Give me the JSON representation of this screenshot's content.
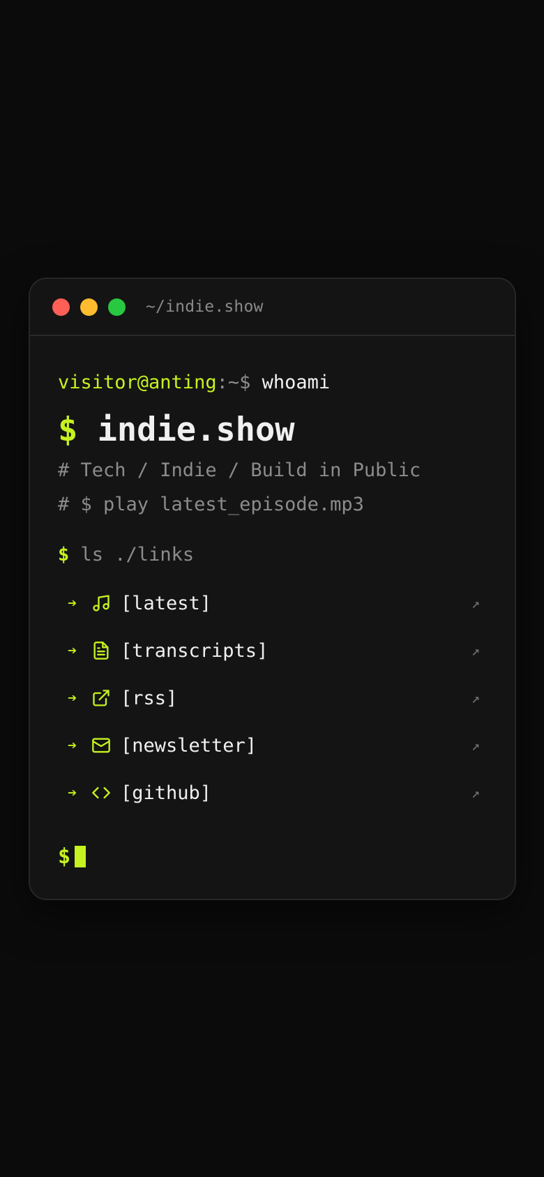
{
  "window": {
    "title": "~/indie.show",
    "dots": [
      "#fe5f57",
      "#febc2e",
      "#28c840"
    ]
  },
  "prompt": {
    "user": "visitor@anting",
    "path": ":~$",
    "command": "whoami"
  },
  "headline": {
    "dollar": "$",
    "name": "indie.show"
  },
  "comments": [
    "# Tech / Indie / Build in Public",
    "# $ play latest_episode.mp3"
  ],
  "ls": {
    "dollar": "$",
    "command": "ls ./links"
  },
  "links": [
    {
      "arrow": "➔",
      "icon": "music-note-icon",
      "label": "[latest]",
      "ext": "↗"
    },
    {
      "arrow": "➔",
      "icon": "document-icon",
      "label": "[transcripts]",
      "ext": "↗"
    },
    {
      "arrow": "➔",
      "icon": "external-link-icon",
      "label": "[rss]",
      "ext": "↗"
    },
    {
      "arrow": "➔",
      "icon": "mail-icon",
      "label": "[newsletter]",
      "ext": "↗"
    },
    {
      "arrow": "➔",
      "icon": "code-icon",
      "label": "[github]",
      "ext": "↗"
    }
  ],
  "final_prompt": {
    "dollar": "$"
  },
  "colors": {
    "accent": "#c6f220",
    "background": "#0b0b0b",
    "terminal": "#141414"
  }
}
